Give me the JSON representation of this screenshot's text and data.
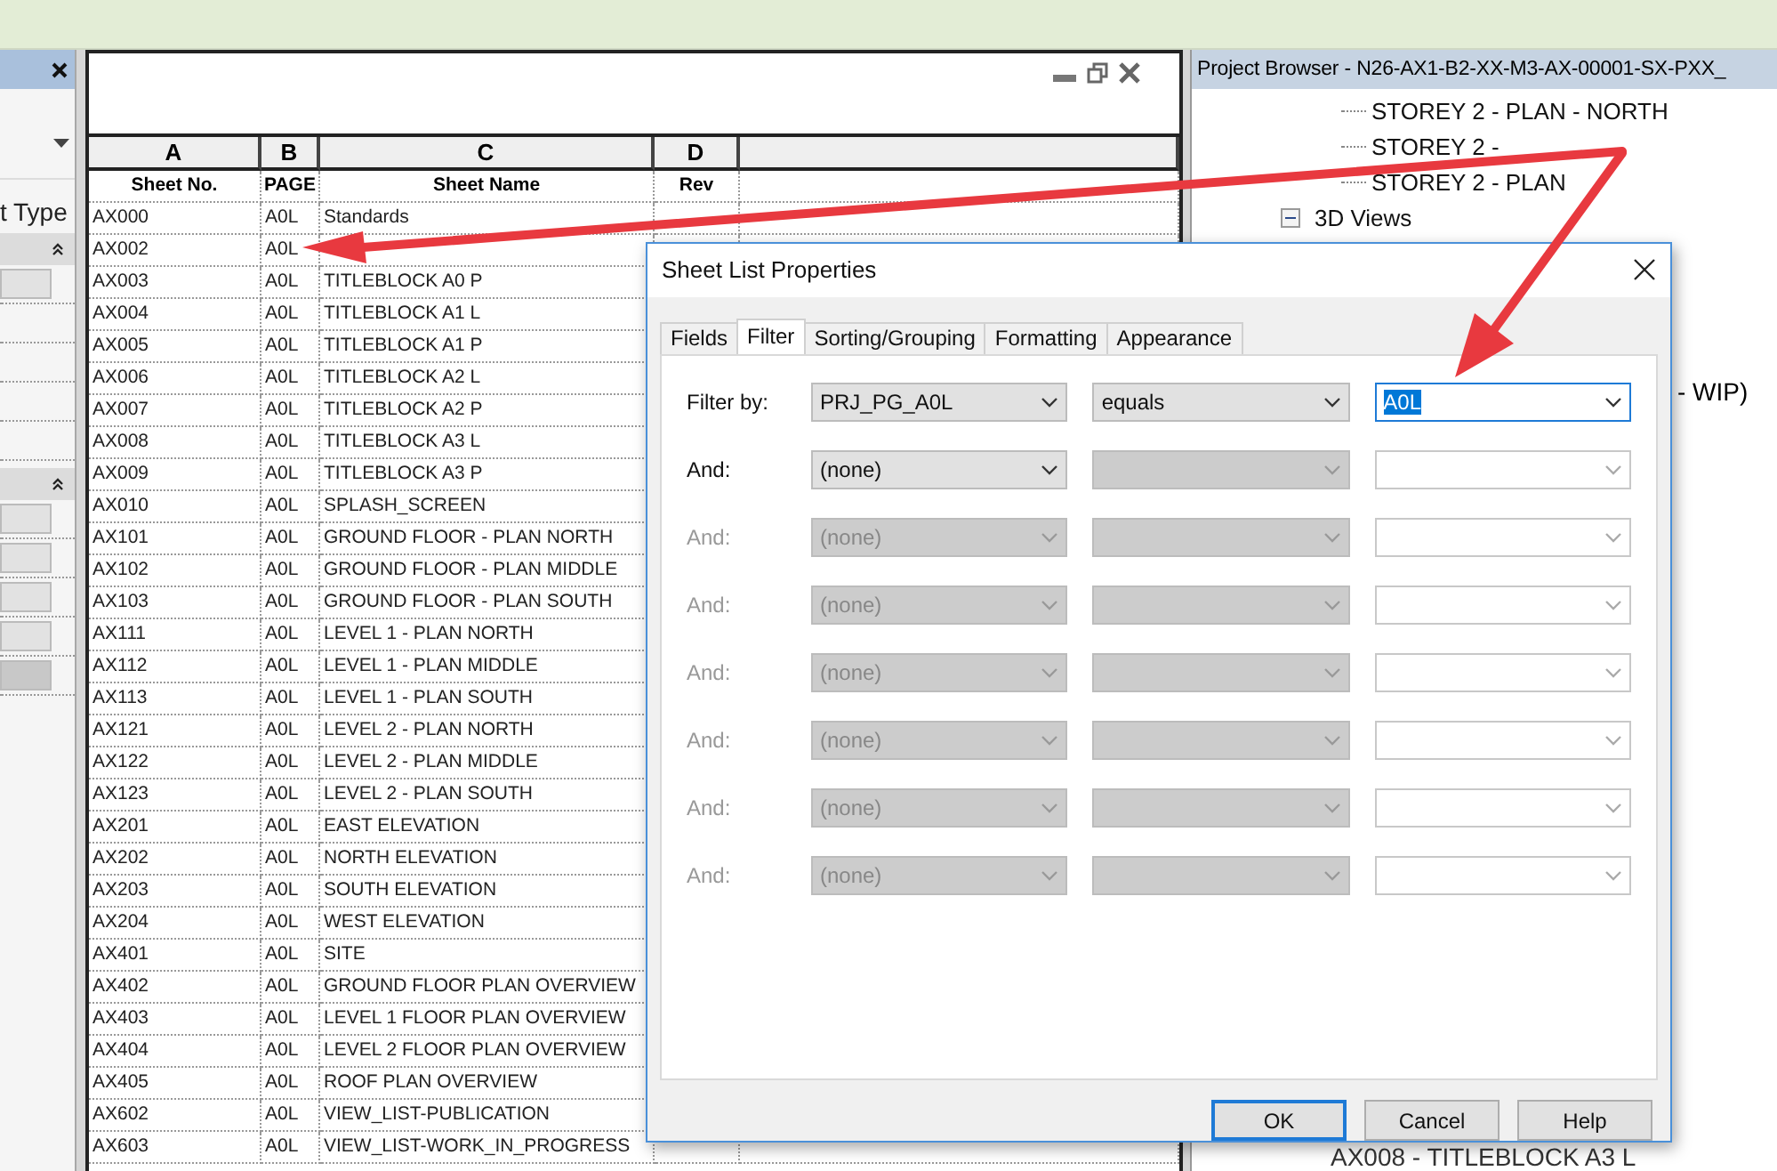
{
  "left_panel": {
    "label": "t Type"
  },
  "schedule": {
    "columns": [
      {
        "letter": "A",
        "heading": "Sheet No."
      },
      {
        "letter": "B",
        "heading": "PAGE"
      },
      {
        "letter": "C",
        "heading": "Sheet Name"
      },
      {
        "letter": "D",
        "heading": "Rev"
      }
    ],
    "rows": [
      [
        "AX000",
        "A0L",
        "Standards"
      ],
      [
        "AX002",
        "A0L"
      ],
      [
        "AX003",
        "A0L",
        "TITLEBLOCK A0 P"
      ],
      [
        "AX004",
        "A0L",
        "TITLEBLOCK A1 L"
      ],
      [
        "AX005",
        "A0L",
        "TITLEBLOCK A1 P"
      ],
      [
        "AX006",
        "A0L",
        "TITLEBLOCK A2 L"
      ],
      [
        "AX007",
        "A0L",
        "TITLEBLOCK A2 P"
      ],
      [
        "AX008",
        "A0L",
        "TITLEBLOCK A3 L"
      ],
      [
        "AX009",
        "A0L",
        "TITLEBLOCK A3 P"
      ],
      [
        "AX010",
        "A0L",
        "SPLASH_SCREEN"
      ],
      [
        "AX101",
        "A0L",
        "GROUND FLOOR - PLAN NORTH"
      ],
      [
        "AX102",
        "A0L",
        "GROUND FLOOR - PLAN MIDDLE"
      ],
      [
        "AX103",
        "A0L",
        "GROUND FLOOR - PLAN SOUTH"
      ],
      [
        "AX111",
        "A0L",
        "LEVEL 1 - PLAN NORTH"
      ],
      [
        "AX112",
        "A0L",
        "LEVEL 1 - PLAN MIDDLE"
      ],
      [
        "AX113",
        "A0L",
        "LEVEL 1 - PLAN SOUTH"
      ],
      [
        "AX121",
        "A0L",
        "LEVEL 2 - PLAN NORTH"
      ],
      [
        "AX122",
        "A0L",
        "LEVEL 2 - PLAN MIDDLE"
      ],
      [
        "AX123",
        "A0L",
        "LEVEL 2 - PLAN SOUTH"
      ],
      [
        "AX201",
        "A0L",
        "EAST ELEVATION"
      ],
      [
        "AX202",
        "A0L",
        "NORTH ELEVATION"
      ],
      [
        "AX203",
        "A0L",
        "SOUTH ELEVATION"
      ],
      [
        "AX204",
        "A0L",
        "WEST ELEVATION"
      ],
      [
        "AX401",
        "A0L",
        "SITE"
      ],
      [
        "AX402",
        "A0L",
        "GROUND FLOOR PLAN OVERVIEW"
      ],
      [
        "AX403",
        "A0L",
        "LEVEL 1 FLOOR PLAN OVERVIEW"
      ],
      [
        "AX404",
        "A0L",
        "LEVEL 2 FLOOR PLAN OVERVIEW"
      ],
      [
        "AX405",
        "A0L",
        "ROOF PLAN OVERVIEW"
      ],
      [
        "AX602",
        "A0L",
        "VIEW_LIST-PUBLICATION"
      ],
      [
        "AX603",
        "A0L",
        "VIEW_LIST-WORK_IN_PROGRESS"
      ]
    ]
  },
  "project_browser": {
    "title": "Project Browser - N26-AX1-B2-XX-M3-AX-00001-SX-PXX_",
    "items": [
      {
        "label": "STOREY 2 - PLAN - NORTH"
      },
      {
        "label": "STOREY 2 -"
      },
      {
        "label": "STOREY 2 - PLAN"
      },
      {
        "label": "3D Views",
        "expanded": true,
        "children": [
          {
            "label": "- WIP)"
          }
        ]
      }
    ],
    "bottom_items": [
      "AX008 - TITLEBLOCK A3 L"
    ]
  },
  "dialog": {
    "title": "Sheet List Properties",
    "tabs": [
      {
        "label": "Fields",
        "selected": false
      },
      {
        "label": "Filter",
        "selected": true
      },
      {
        "label": "Sorting/Grouping",
        "selected": false
      },
      {
        "label": "Formatting",
        "selected": false
      },
      {
        "label": "Appearance",
        "selected": false
      }
    ],
    "filters": [
      {
        "label": "Filter by:",
        "field": "PRJ_PG_A0L",
        "condition": "equals",
        "value": "A0L",
        "enabled": true,
        "condition_enabled": true,
        "focused": true
      },
      {
        "label": "And:",
        "field": "(none)",
        "enabled": true,
        "condition_enabled": false,
        "focused": false
      },
      {
        "label": "And:",
        "field": "(none)",
        "enabled": false,
        "condition_enabled": false,
        "focused": false
      },
      {
        "label": "And:",
        "field": "(none)",
        "enabled": false,
        "condition_enabled": false,
        "focused": false
      },
      {
        "label": "And:",
        "field": "(none)",
        "enabled": false,
        "condition_enabled": false,
        "focused": false
      },
      {
        "label": "And:",
        "field": "(none)",
        "enabled": false,
        "condition_enabled": false,
        "focused": false
      },
      {
        "label": "And:",
        "field": "(none)",
        "enabled": false,
        "condition_enabled": false,
        "focused": false
      },
      {
        "label": "And:",
        "field": "(none)",
        "enabled": false,
        "condition_enabled": false,
        "focused": false
      }
    ],
    "buttons": [
      {
        "label": "OK",
        "default": true
      },
      {
        "label": "Cancel",
        "default": false
      },
      {
        "label": "Help",
        "default": false
      }
    ]
  }
}
